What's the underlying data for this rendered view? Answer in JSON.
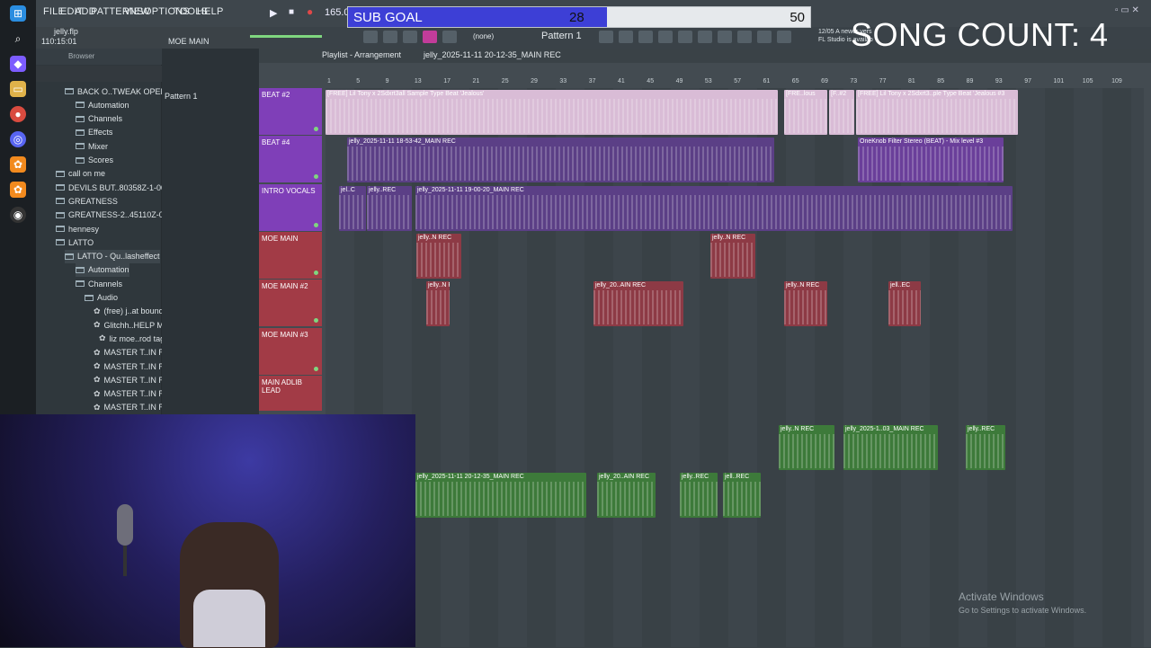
{
  "menu": [
    "FILE",
    "EDIT",
    "ADD",
    "PATTERNS",
    "VIEW",
    "OPTIONS",
    "TOOLS",
    "HELP"
  ],
  "project": {
    "filename": "jelly.flp",
    "time": "110:15:01",
    "hint": "MOE MAIN",
    "tempo": "165.0"
  },
  "toolbar": {
    "pattern": "Pattern 1",
    "snap": "(none)"
  },
  "overlay": {
    "sub_goal_label": "SUB GOAL",
    "sub_goal_current": 28,
    "sub_goal_max": 50,
    "sub_goal_fraction": 0.56,
    "song_count": "SONG COUNT: 4",
    "update_notice_line1": "A newer vers",
    "update_notice_line2": "FL Studio is availab",
    "update_date": "12/05"
  },
  "browser": {
    "title": "Browser",
    "items": [
      {
        "label": "BACK O..TWEAK OPEN",
        "type": "folder"
      },
      {
        "label": "Automation",
        "type": "folder"
      },
      {
        "label": "Channels",
        "type": "folder"
      },
      {
        "label": "Effects",
        "type": "folder"
      },
      {
        "label": "Mixer",
        "type": "folder"
      },
      {
        "label": "Scores",
        "type": "folder"
      },
      {
        "label": "call on me",
        "type": "folder"
      },
      {
        "label": "DEVILS BUT..80358Z-1-001",
        "type": "folder"
      },
      {
        "label": "GREATNESS",
        "type": "folder"
      },
      {
        "label": "GREATNESS-2..45110Z-001",
        "type": "folder"
      },
      {
        "label": "hennesy",
        "type": "folder"
      },
      {
        "label": "LATTO",
        "type": "folder"
      },
      {
        "label": "LATTO - Qu..lasheffect",
        "type": "folder"
      },
      {
        "label": "Automation",
        "type": "folder"
      },
      {
        "label": "Channels",
        "type": "folder"
      },
      {
        "label": "Audio",
        "type": "folder"
      },
      {
        "label": "(free) j..at bound",
        "type": "file"
      },
      {
        "label": "Glitchh..HELP ME",
        "type": "file"
      },
      {
        "label": "liz moe..rod tag",
        "type": "file"
      },
      {
        "label": "MASTER T..IN REC",
        "type": "file"
      },
      {
        "label": "MASTER T..IN REC",
        "type": "file"
      },
      {
        "label": "MASTER T..IN REC",
        "type": "file"
      },
      {
        "label": "MASTER T..IN REC",
        "type": "file"
      },
      {
        "label": "MASTER T..IN REC",
        "type": "file"
      },
      {
        "label": "MASTER T..IN REC",
        "type": "file"
      }
    ]
  },
  "patterns": {
    "item": "Pattern 1"
  },
  "playlist": {
    "title": "Playlist - Arrangement",
    "breadcrumb": "jelly_2025-11-11 20-12-35_MAIN REC",
    "ruler": [
      "1",
      "5",
      "9",
      "13",
      "17",
      "21",
      "25",
      "29",
      "33",
      "37",
      "41",
      "45",
      "49",
      "53",
      "57",
      "61",
      "65",
      "69",
      "73",
      "77",
      "81",
      "85",
      "89",
      "93",
      "97",
      "101",
      "105",
      "109"
    ],
    "tracks": [
      {
        "name": "BEAT #2",
        "color": "#7f3fb8"
      },
      {
        "name": "BEAT #4",
        "color": "#7f3fb8"
      },
      {
        "name": "INTRO VOCALS",
        "color": "#7f3fb8"
      },
      {
        "name": "MOE MAIN",
        "color": "#a23b46"
      },
      {
        "name": "MOE MAIN #2",
        "color": "#a23b46"
      },
      {
        "name": "MOE MAIN #3",
        "color": "#a23b46"
      },
      {
        "name": "MAIN ADLIB LEAD",
        "color": "#a23b46"
      }
    ],
    "clips": [
      {
        "title": "[FREE] Lil Tony x 2Sdxrt3all Sample Type Beat 'Jealous'",
        "row": 0,
        "color": "#d9bcd6"
      },
      {
        "title": "[FRE..lous",
        "row": 0,
        "color": "#d9bcd6"
      },
      {
        "title": "[F..#2",
        "row": 0,
        "color": "#d9bcd6"
      },
      {
        "title": "[FREE] Lil Tony x 2Sdxrt3..ple Type Beat 'Jealous #3",
        "row": 0,
        "color": "#d9bcd6"
      },
      {
        "title": "jelly_2025-11-11 18-53-42_MAIN REC",
        "row": 1,
        "color": "#5b3f86"
      },
      {
        "title": "OneKnob Filter Stereo (BEAT) - Mix level #3",
        "row": 1,
        "color": "#6a3f9a"
      },
      {
        "title": "jel..C",
        "row": 2,
        "color": "#5b3f86"
      },
      {
        "title": "jelly..REC",
        "row": 2,
        "color": "#5b3f86"
      },
      {
        "title": "jelly_2025-11-11 19-00-20_MAIN REC",
        "row": 2,
        "color": "#5b3f86"
      },
      {
        "title": "jelly..N REC",
        "row": 3,
        "color": "#8d3a45"
      },
      {
        "title": "jelly..N REC",
        "row": 3,
        "color": "#8d3a45"
      },
      {
        "title": "jelly..N REC",
        "row": 4,
        "color": "#8d3a45"
      },
      {
        "title": "jelly_20..AIN REC",
        "row": 4,
        "color": "#8d3a45"
      },
      {
        "title": "jelly..N REC",
        "row": 4,
        "color": "#8d3a45"
      },
      {
        "title": "jell..EC",
        "row": 4,
        "color": "#8d3a45"
      },
      {
        "title": "jelly..N REC",
        "row": 7,
        "color": "#3d7a3a"
      },
      {
        "title": "jelly_2025-1..03_MAIN REC",
        "row": 7,
        "color": "#3d7a3a"
      },
      {
        "title": "jelly..REC",
        "row": 7,
        "color": "#3d7a3a"
      },
      {
        "title": "jelly_2025-11-11 20-12-35_MAIN REC",
        "row": 8,
        "color": "#3d7a3a"
      },
      {
        "title": "jelly_20..AIN REC",
        "row": 8,
        "color": "#3d7a3a"
      },
      {
        "title": "jelly..REC",
        "row": 8,
        "color": "#3d7a3a"
      },
      {
        "title": "jell..REC",
        "row": 8,
        "color": "#3d7a3a"
      }
    ]
  },
  "windows_watermark": {
    "line1": "Activate Windows",
    "line2": "Go to Settings to activate Windows."
  },
  "colors": {
    "accent": "#3d3fd6",
    "beat": "#7f3fb8",
    "vocal": "#a23b46",
    "adlib": "#3d7a3a"
  }
}
